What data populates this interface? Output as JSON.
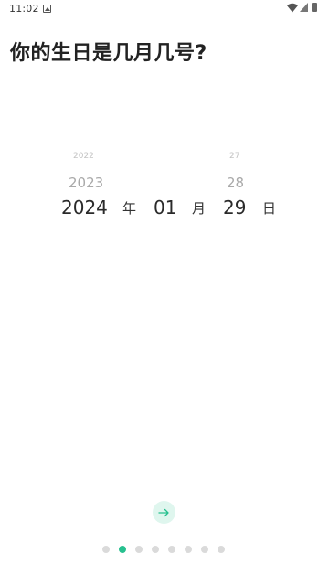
{
  "status_bar": {
    "time": "11:02"
  },
  "title": "你的生日是几月几号?",
  "picker": {
    "year": {
      "above2": "2022",
      "above1": "2023",
      "selected": "2024",
      "unit": "年"
    },
    "month": {
      "selected": "01",
      "unit": "月"
    },
    "day": {
      "above2": "27",
      "above1": "28",
      "selected": "29",
      "unit": "日"
    }
  },
  "pager": {
    "total": 8,
    "active_index": 1
  },
  "colors": {
    "accent": "#27c08f",
    "accent_light": "#dff6ee",
    "dot_inactive": "#dadada"
  }
}
